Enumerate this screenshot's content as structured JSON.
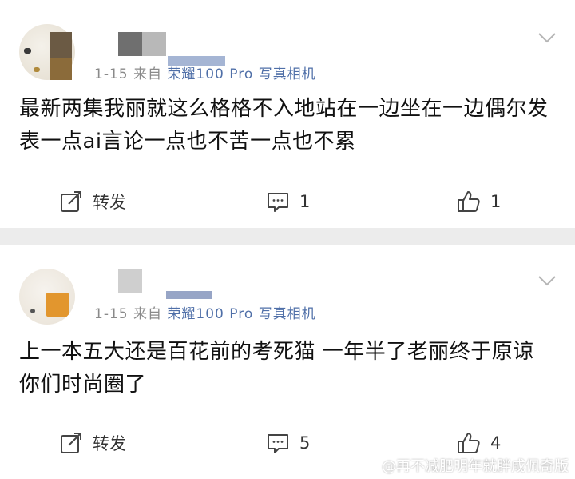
{
  "posts": [
    {
      "meta_prefix": "1-15  来自",
      "device": "荣耀100 Pro 写真相机",
      "text": "最新两集我丽就这么格格不入地站在一边坐在一边偶尔发表一点ai言论一点也不苦一点也不累",
      "repost_label": "转发",
      "comment_count": "1",
      "like_count": "1"
    },
    {
      "meta_prefix": "1-15  来自",
      "device": "荣耀100 Pro 写真相机",
      "text": "上一本五大还是百花前的考死猫 一年半了老丽终于原谅你们时尚圈了",
      "repost_label": "转发",
      "comment_count": "5",
      "like_count": "4"
    }
  ],
  "watermark": "@再不减肥明年就胖成佩奇版",
  "colors": {
    "device_link": "#4f6fa8",
    "meta_gray": "#8a8a8a",
    "divider": "#ececec"
  },
  "icons": {
    "repost": "share-edit-icon",
    "comment": "comment-icon",
    "like": "thumbs-up-icon",
    "menu": "chevron-down-icon"
  }
}
